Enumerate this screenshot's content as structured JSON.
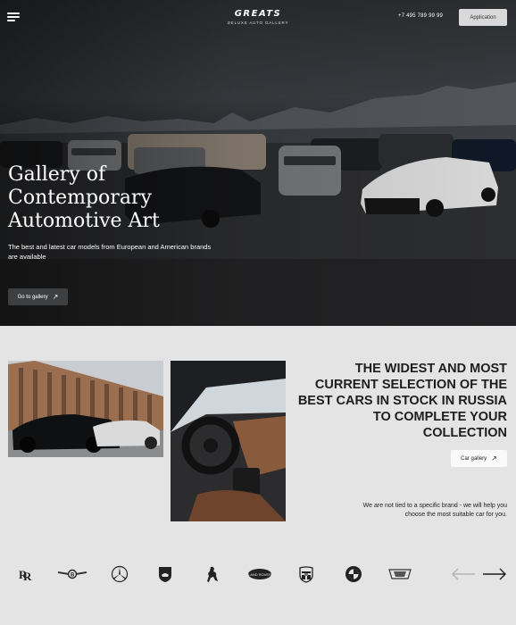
{
  "header": {
    "logo_word": "GREATS",
    "logo_sub": "DELUXE AUTO GALLERY",
    "phone": "+7 495 789 99 99",
    "application_label": "Application"
  },
  "hero": {
    "title": "Gallery of Contemporary Automotive Art",
    "subtitle": "The best and latest car models from European and American brands are available",
    "cta_label": "Go to gallery"
  },
  "showcase": {
    "headline": "THE WIDEST AND MOST CURRENT SELECTION OF THE BEST CARS IN STOCK IN RUSSIA TO COMPLETE YOUR COLLECTION",
    "cta_label": "Car gallery",
    "note": "We are not tied to a specific brand - we will help you choose the most suitable car for you."
  },
  "brands": [
    {
      "name": "rolls-royce-logo"
    },
    {
      "name": "bentley-logo"
    },
    {
      "name": "mercedes-benz-logo"
    },
    {
      "name": "lamborghini-logo"
    },
    {
      "name": "ferrari-logo"
    },
    {
      "name": "land-rover-logo",
      "text": "LAND ROVER"
    },
    {
      "name": "porsche-logo"
    },
    {
      "name": "bmw-logo"
    },
    {
      "name": "cadillac-logo"
    }
  ],
  "colors": {
    "background": "#e4e4e4",
    "hero_dark": "#2b2d30",
    "button_light": "#d9d9d9",
    "button_dark": "#3e3f41",
    "text_dark": "#1d1d1d"
  }
}
